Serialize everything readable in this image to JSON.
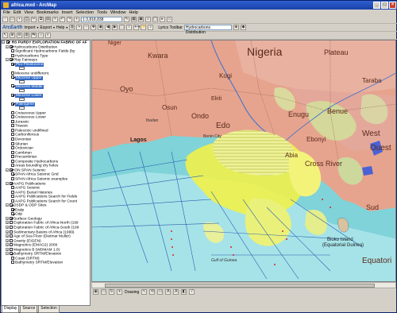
{
  "window": {
    "title": "africa.mxd - ArcMap"
  },
  "menu": [
    "File",
    "Edit",
    "View",
    "Bookmarks",
    "Insert",
    "Selection",
    "Tools",
    "Window",
    "Help"
  ],
  "toolbar": {
    "scale": "1:3,818,838",
    "arcearth": "ArcEarth",
    "import": "Import",
    "export": "Export",
    "help": "Help",
    "lyrics_toolbar": "Lyrics Toolbar",
    "layer_combo": "Hydrocarbons Distribution"
  },
  "toc": {
    "root": "RS PURDY EXPLORATION FABRIC OF AF",
    "rows": [
      {
        "label": "Hydrocarbons Distribution",
        "level": 1,
        "check": true,
        "expander": "-"
      },
      {
        "label": "Significant Hydrocarbons Fields (by",
        "level": 2,
        "check": false
      },
      {
        "label": "Hydrocarbons Type",
        "level": 2,
        "check": false
      },
      {
        "label": "Play Fairways",
        "level": 1,
        "check": true,
        "expander": "-"
      },
      {
        "label": "Plio-Pleistocene",
        "level": 2,
        "check": true,
        "selected": true
      },
      {
        "label": "",
        "level": 3,
        "swatch": "#ffffff"
      },
      {
        "label": "Miocene undifferent.",
        "level": 2,
        "check": false
      },
      {
        "label": "Miocene Upper",
        "level": 2,
        "check": true,
        "selected": true
      },
      {
        "label": "",
        "level": 3,
        "swatch": "#ffffff"
      },
      {
        "label": "Miocene Middle",
        "level": 2,
        "check": true,
        "selected": true
      },
      {
        "label": "",
        "level": 3,
        "swatch": "#ffffff"
      },
      {
        "label": "Miocene Lower",
        "level": 2,
        "check": true,
        "selected": true
      },
      {
        "label": "",
        "level": 3,
        "swatch": "#ffffff"
      },
      {
        "label": "Paleogene",
        "level": 2,
        "check": true,
        "selected": true
      },
      {
        "label": "",
        "level": 3,
        "swatch": "#ffffff"
      },
      {
        "label": "Cretaceous Upper",
        "level": 2,
        "check": false
      },
      {
        "label": "Cretaceous Lower",
        "level": 2,
        "check": false
      },
      {
        "label": "Jurassic",
        "level": 2,
        "check": false
      },
      {
        "label": "Triassic",
        "level": 2,
        "check": false
      },
      {
        "label": "Paleozoic undifined",
        "level": 2,
        "check": false
      },
      {
        "label": "Carboniferous",
        "level": 2,
        "check": false
      },
      {
        "label": "Devonian",
        "level": 2,
        "check": false
      },
      {
        "label": "Silurian",
        "level": 2,
        "check": false
      },
      {
        "label": "Ordovician",
        "level": 2,
        "check": false
      },
      {
        "label": "Cambrian",
        "level": 2,
        "check": false
      },
      {
        "label": "Precambrian",
        "level": 2,
        "check": false
      },
      {
        "label": "Composite Hydrocarbons",
        "level": 2,
        "check": false
      },
      {
        "label": "Areas bounding dry holes",
        "level": 2,
        "check": false
      },
      {
        "label": "ION SPAN Seismic",
        "level": 1,
        "check": true,
        "expander": "-"
      },
      {
        "label": "SPAN Africa Seismic Grid",
        "level": 2,
        "check": true
      },
      {
        "label": "SPAN Africa Seismic examples",
        "level": 2,
        "check": false
      },
      {
        "label": "AAPG Publications",
        "level": 1,
        "check": true,
        "expander": "-"
      },
      {
        "label": "AAPG Seismic",
        "level": 2,
        "check": false
      },
      {
        "label": "AAPG Burial Histories",
        "level": 2,
        "check": false
      },
      {
        "label": "AAPG Publications Search for Fields",
        "level": 2,
        "check": false
      },
      {
        "label": "AAPG Publications Search for Count",
        "level": 2,
        "check": false
      },
      {
        "label": "DSDP & ODP Sites",
        "level": 1,
        "check": true,
        "expander": "-"
      },
      {
        "label": "Dsdp",
        "level": 2,
        "check": true
      },
      {
        "label": "Odp",
        "level": 2,
        "check": true
      },
      {
        "label": "Surface Geology",
        "level": 1,
        "check": true,
        "expander": "+"
      },
      {
        "label": "Exploration Fabric of Africa-North (199",
        "level": 1,
        "check": false,
        "expander": "+"
      },
      {
        "label": "Exploration Fabric of Africa-South (199",
        "level": 1,
        "check": false,
        "expander": "+"
      },
      {
        "label": "Sedimentary Basins of Africa (1999)",
        "level": 1,
        "check": false,
        "expander": "+"
      },
      {
        "label": "Age of Sea Floor (Dietmar Muller)",
        "level": 1,
        "check": false,
        "expander": "+"
      },
      {
        "label": "Gravity (EIGEN)",
        "level": 1,
        "check": false,
        "expander": "+"
      },
      {
        "label": "Magnetics (EMAG2) 2009",
        "level": 1,
        "check": false,
        "expander": "+"
      },
      {
        "label": "Magnetics B (WDMAM 1.0)",
        "level": 1,
        "check": false,
        "expander": "+"
      },
      {
        "label": "Bathymetry SRTM/Elevation",
        "level": 1,
        "check": true,
        "expander": "-"
      },
      {
        "label": "Coast (SRTM)",
        "level": 2,
        "check": false
      },
      {
        "label": "Bathymetry SRTM/Elevation",
        "level": 2,
        "check": false
      }
    ]
  },
  "toc_tabs": [
    "Display",
    "Source",
    "Selection"
  ],
  "map_labels": {
    "nigeria": "Nigeria",
    "plateau": "Plateau",
    "kwara": "Kwara",
    "kogi": "Kogi",
    "niger": "Niger",
    "taraba": "Taraba",
    "oyo": "Oyo",
    "ibadan": "Ibadan",
    "osun": "Osun",
    "ondo": "Ondo",
    "ekiti": "Ekiti",
    "enugu": "Enugu",
    "benue": "Benue",
    "lagos": "Lagos",
    "edo": "Edo",
    "benin_city": "Benin City",
    "abia": "Abia",
    "cross_river": "Cross River",
    "ebonyi": "Ebonyi",
    "west": "West",
    "sud": "Sud",
    "ouest": "Ouest",
    "bioko": "Bioko Island",
    "equatorial_guinea": "(Equatorial Guinea)",
    "gulf_guinea": "Gulf of Guinea",
    "equatori": "Equatori"
  },
  "maptools": {
    "drawing": "Drawing"
  },
  "colors": {
    "land": "#e6a48e",
    "sea": "#7fd3d9",
    "deep_sea": "#aee6ea",
    "fairway": "#f1f14a",
    "fairway_light": "#e9f09a"
  }
}
